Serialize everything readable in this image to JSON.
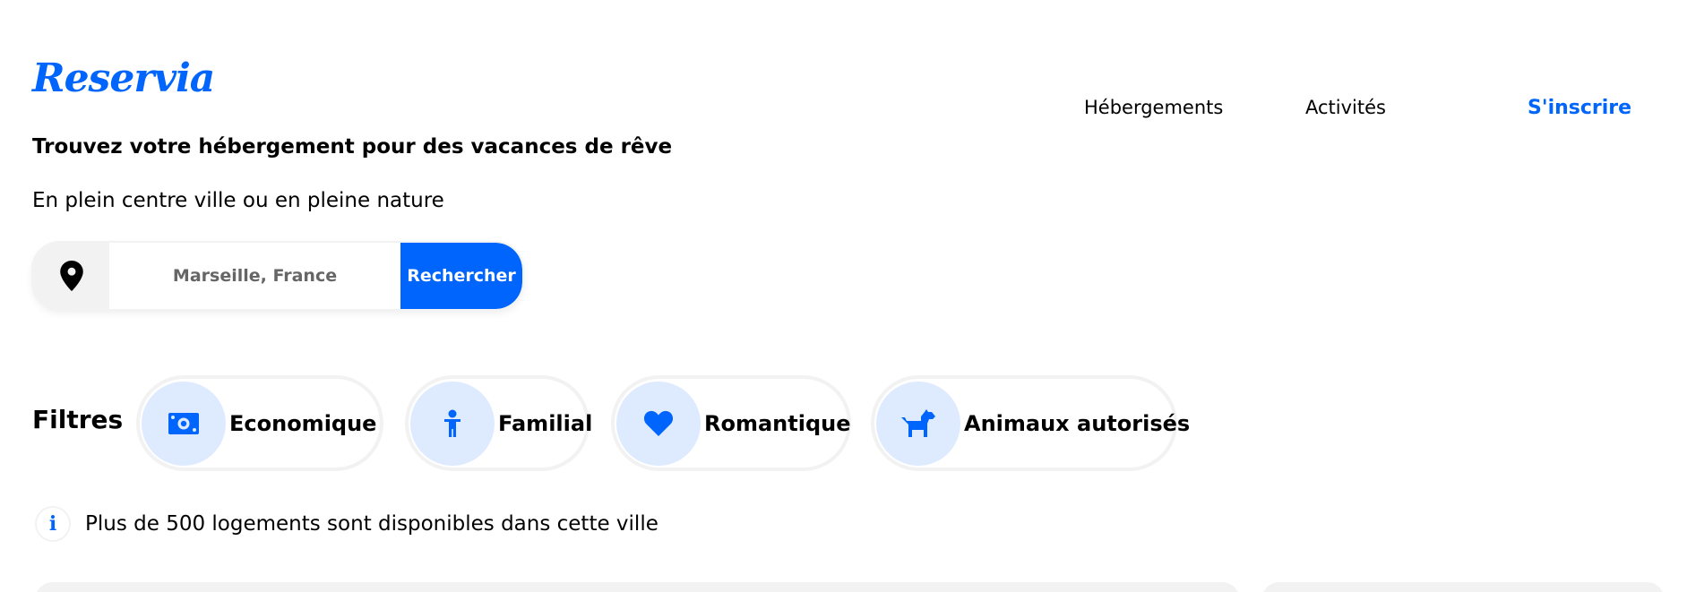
{
  "header": {
    "logo": "Reservia",
    "nav": {
      "hebergements": "Hébergements",
      "activites": "Activités",
      "signup": "S'inscrire"
    }
  },
  "hero": {
    "title": "Trouvez votre hébergement pour des vacances de rêve",
    "subtitle": "En plein centre ville ou en pleine nature"
  },
  "search": {
    "icon": "location-pin-icon",
    "placeholder": "Marseille, France",
    "button_label": "Rechercher"
  },
  "filters": {
    "label": "Filtres",
    "items": [
      {
        "label": "Economique",
        "icon": "money-bill-icon"
      },
      {
        "label": "Familial",
        "icon": "child-icon"
      },
      {
        "label": "Romantique",
        "icon": "heart-icon"
      },
      {
        "label": "Animaux autorisés",
        "icon": "dog-icon"
      }
    ]
  },
  "info": {
    "icon_glyph": "i",
    "text": "Plus de 500 logements sont disponibles dans cette ville"
  },
  "colors": {
    "primary": "#0065FC",
    "chip_icon_bg": "#DEEBFF",
    "light_gray": "#F2F2F2"
  }
}
